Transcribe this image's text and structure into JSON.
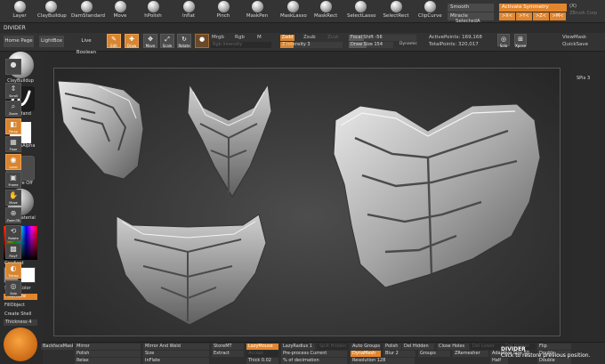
{
  "topshelf": {
    "brushes": [
      "Layer",
      "ClayBuildup",
      "DamStandard",
      "Move",
      "hPolish",
      "Inflat",
      "Pinch",
      "MaskPen",
      "MaskLasso",
      "MaskRect",
      "SelectLasso",
      "SelectRect",
      "ClipCurve"
    ],
    "smooth": "Smooth",
    "miracle": "Miracle",
    "selected": "SelectedA",
    "symmetry": "Activate Symmetry",
    "symmetry_key": "(X)",
    "axes": [
      ">X<",
      ">Y<",
      ">Z<",
      ">M<"
    ],
    "watermark": "ZBrush Corp"
  },
  "toolbar2": {
    "divider": "DIVIDER"
  },
  "toolbar3": {
    "home": "Home Page",
    "lightbox": "LightBox",
    "live_boolean": "Live Boolean",
    "icons": [
      "Edit",
      "Draw",
      "Move",
      "Scale",
      "Rotate"
    ],
    "mrgb": "Mrgb",
    "rgb": "Rgb",
    "m": "M",
    "rgb_intensity": "Rgb Intensity",
    "zadd": "Zadd",
    "zsub": "Zsub",
    "zcut": "Zcut",
    "z_intensity": "Z Intensity 3",
    "focal_shift": "Focal Shift -56",
    "draw_size": "Draw Size 154",
    "dynamic": "Dynamic",
    "active_points": "ActivePoints: 169,168",
    "total_points": "TotalPoints: 320,017",
    "solo": "Solo",
    "xpose": "Xpose",
    "viewmask": "ViewMask",
    "quicksave": "QuickSave"
  },
  "leftbar": {
    "claybuildup": "ClayBuildup",
    "freehand": "FreeHand",
    "brush_alpha": "~BrushAlpha",
    "texture_off": "Texture Off",
    "basic_material": "BasicMaterial",
    "gradient": "Gradient",
    "switch_color": "SwitchColor",
    "alternate": "Alternate",
    "fill_object": "FillObject",
    "create_shell": "Create Shell",
    "thickness": "Thickness 4"
  },
  "rightbar": {
    "spix": "SPix 3",
    "buttons": [
      "",
      "Scroll",
      "Zoom",
      "Actual",
      "AAHalf",
      "Persp",
      "Floor",
      "Local",
      "L.Sym",
      "Frame",
      "Move",
      "Zoom3D",
      "Rotate",
      "Line Fill",
      "PolyF",
      "Transp",
      "Ghost",
      "Solo",
      "Xpose"
    ]
  },
  "bottombar": {
    "row1": [
      "BackfaceMask",
      "Mirror",
      "Mirror And Weld",
      "StoreMT",
      "LazyMouse",
      "LazyRadius 1",
      "Split Hidden",
      "Auto Groups",
      "Polish",
      "Del Hidden",
      "Close Holes",
      "Del Lower",
      "Del Higher",
      "Flip"
    ],
    "row2": [
      "",
      "Polish",
      "Size",
      "",
      "Extract",
      "Accept",
      "Pre-process Current",
      "",
      "DynaMesh",
      "Blur 2",
      "Groups",
      "ZRemesher",
      "Adaptive Size 50",
      "Double"
    ],
    "row3": [
      "",
      "Relax",
      "",
      "InFlate",
      "",
      "Thick 0.02",
      "% of decimation",
      "Resolution 128",
      "",
      "",
      "Half",
      "Double"
    ],
    "divider": "DIVIDER",
    "tooltip": "Click to restore previous position."
  },
  "colors": {
    "accent": "#e2862e",
    "primary": "#ff0000",
    "secondary": "#ffffff"
  }
}
